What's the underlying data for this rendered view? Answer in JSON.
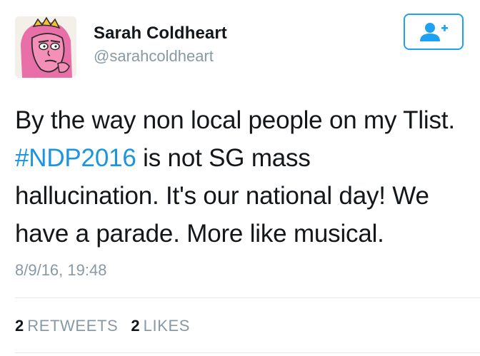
{
  "user": {
    "display_name": "Sarah Coldheart",
    "handle": "@sarahcoldheart",
    "avatar_icon": "avatar-cartoon-princess"
  },
  "follow_button": {
    "icon": "add-user-icon",
    "color": "#1da1f2"
  },
  "tweet": {
    "lines": [
      "By the way non local people on my Tlist.",
      "",
      "hallucination. It's our national day! We",
      "have a parade. More like musical."
    ],
    "hashtag": "#NDP2016",
    "hashtag_after": " is not SG mass",
    "hashtag_color": "#1b95e0",
    "timestamp": "8/9/16, 19:48"
  },
  "stats": {
    "retweets_count": "2",
    "retweets_label": "RETWEETS",
    "likes_count": "2",
    "likes_label": "LIKES"
  }
}
